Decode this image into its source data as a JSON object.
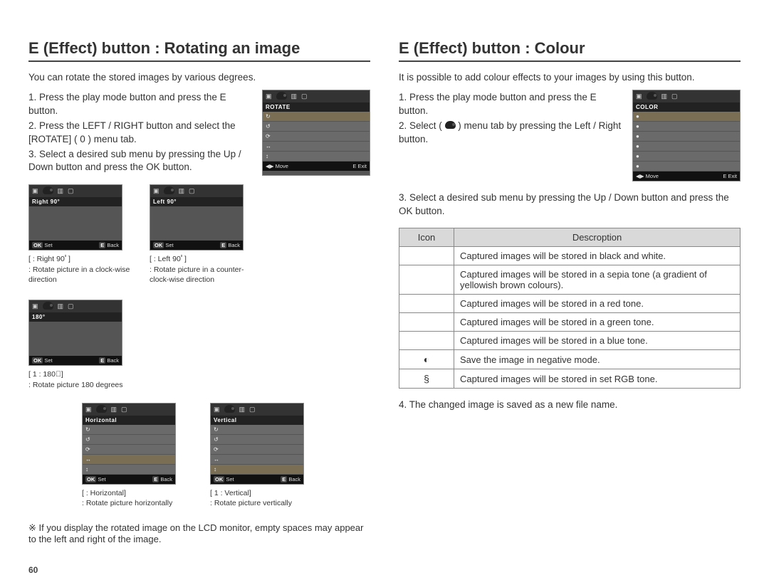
{
  "page_number": "60",
  "left": {
    "heading": "E (Effect) button : Rotating an image",
    "intro": "You can rotate the stored images by various degrees.",
    "step1": "1. Press the play mode button and press the E button.",
    "step2": "2. Press the LEFT / RIGHT button and select the [ROTATE] ( 0 ) menu tab.",
    "step3": "3. Select a desired sub menu by pressing the Up / Down button and press the OK button.",
    "main_lcd": {
      "title": "ROTATE",
      "foot_left": "◀▶ Move",
      "foot_right": "E  Exit"
    },
    "thumbs": [
      {
        "title": "Right 90°",
        "foot_left": "OK Set",
        "foot_right": "E  Back",
        "cap_head": "[     : Right 90ﾟ]",
        "cap_body": ": Rotate picture in a clock-wise direction"
      },
      {
        "title": "Left 90°",
        "foot_left": "OK Set",
        "foot_right": "E  Back",
        "cap_head": "[     : Left 90ﾟ]",
        "cap_body": ": Rotate picture in a counter-clock-wise direction"
      },
      {
        "title": "180°",
        "foot_left": "OK Set",
        "foot_right": "E  Back",
        "cap_head": "[  1  : 180ﾟ]",
        "cap_body": ": Rotate picture 180 degrees"
      }
    ],
    "thumbs2": [
      {
        "title": "Horizontal",
        "foot_left": "OK Set",
        "foot_right": "E  Back",
        "cap_head": "[     : Horizontal]",
        "cap_body": ": Rotate picture horizontally"
      },
      {
        "title": "Vertical",
        "foot_left": "OK Set",
        "foot_right": "E  Back",
        "cap_head": "[  1  : Vertical]",
        "cap_body": ": Rotate picture vertically"
      }
    ],
    "note": "※ If you display the rotated image on the LCD monitor, empty spaces may appear to the left and right of the image."
  },
  "right": {
    "heading": "E (Effect) button : Colour",
    "intro": "It is possible to add colour effects to your images by using this button.",
    "step1": "1. Press the play mode button and press the E button.",
    "step2": "2. Select (      ) menu tab by pressing the Left / Right button.",
    "step3": "3. Select a desired sub menu by pressing the Up / Down button and press the OK button.",
    "step4": "4. The changed image is saved as a new file name.",
    "lcd": {
      "title": "COLOR",
      "foot_left": "◀▶ Move",
      "foot_right": "E  Exit"
    },
    "table": {
      "head_icon": "Icon",
      "head_desc": "Descroption",
      "rows": [
        {
          "icon": "",
          "desc": "Captured images will be stored in black and white."
        },
        {
          "icon": "",
          "desc": "Captured images will be stored in a sepia tone (a gradient of yellowish brown colours)."
        },
        {
          "icon": "",
          "desc": "Captured images will be stored in a red tone."
        },
        {
          "icon": "",
          "desc": "Captured images will be stored in a green tone."
        },
        {
          "icon": "",
          "desc": "Captured images will be stored in a blue tone."
        },
        {
          "icon": "◐",
          "desc": "Save the image in negative mode."
        },
        {
          "icon": "§",
          "desc": "Captured images will be stored in set RGB tone."
        }
      ]
    }
  }
}
